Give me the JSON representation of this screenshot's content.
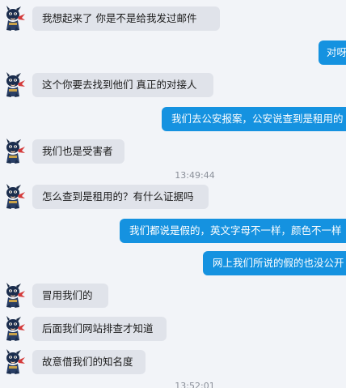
{
  "colors": {
    "background": "#f2f4f8",
    "incoming_bubble": "#e0e3ea",
    "outgoing_bubble": "#1592e0",
    "timestamp_text": "#8a8f99"
  },
  "contact": {
    "avatar_icon": "ninja-cat-avatar-icon"
  },
  "messages": [
    {
      "direction": "in",
      "text": "我想起来了   你是不是给我发过邮件"
    },
    {
      "direction": "out",
      "text": "对呀"
    },
    {
      "direction": "in",
      "text": "这个你要去找到他们  真正的对接人"
    },
    {
      "direction": "out",
      "text": "我们去公安报案，公安说查到是租用的"
    },
    {
      "direction": "in",
      "text": "我们也是受害者"
    },
    {
      "direction": "time",
      "text": "13:49:44"
    },
    {
      "direction": "in",
      "text": "怎么查到是租用的？有什么证据吗"
    },
    {
      "direction": "out",
      "text": "我们都说是假的，英文字母不一样，颜色不一样"
    },
    {
      "direction": "out",
      "text": "网上我们所说的假的也没公开"
    },
    {
      "direction": "in",
      "text": "冒用我们的"
    },
    {
      "direction": "in",
      "text": "后面我们网站排查才知道"
    },
    {
      "direction": "in",
      "text": "故意借我们的知名度"
    },
    {
      "direction": "time",
      "text": "13:52:01"
    }
  ]
}
